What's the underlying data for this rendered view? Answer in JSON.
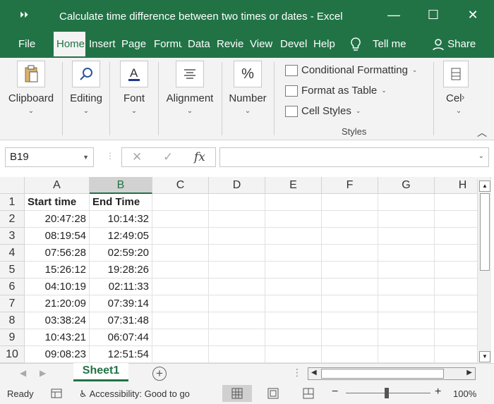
{
  "titlebar": {
    "quick_access": "⏵⏵",
    "title": "Calculate time difference between two times or dates  -  Excel",
    "minimize": "—",
    "restore": "☐",
    "close": "✕"
  },
  "tabs": {
    "file": "File",
    "home": "Home",
    "insert": "Insert",
    "page": "Page I",
    "formulas": "Formu",
    "data": "Data",
    "review": "Revie",
    "view": "View",
    "developer": "Devel",
    "help": "Help",
    "tell_me": "Tell me",
    "share": "Share"
  },
  "ribbon": {
    "clipboard": "Clipboard",
    "editing": "Editing",
    "font": "Font",
    "alignment": "Alignment",
    "number": "Number",
    "conditional_formatting": "Conditional Formatting",
    "format_as_table": "Format as Table",
    "cell_styles": "Cell Styles",
    "styles_group": "Styles",
    "cells": "Cel"
  },
  "formula_bar": {
    "name_box": "B19",
    "fx": "fx",
    "cancel": "✕",
    "enter": "✓",
    "value": ""
  },
  "grid": {
    "columns": [
      "A",
      "B",
      "C",
      "D",
      "E",
      "F",
      "G",
      "H"
    ],
    "selected_column": "B",
    "rows": [
      {
        "n": "1",
        "a": "Start time",
        "b": "End Time"
      },
      {
        "n": "2",
        "a": "20:47:28",
        "b": "10:14:32"
      },
      {
        "n": "3",
        "a": "08:19:54",
        "b": "12:49:05"
      },
      {
        "n": "4",
        "a": "07:56:28",
        "b": "02:59:20"
      },
      {
        "n": "5",
        "a": "15:26:12",
        "b": "19:28:26"
      },
      {
        "n": "6",
        "a": "04:10:19",
        "b": "02:11:33"
      },
      {
        "n": "7",
        "a": "21:20:09",
        "b": "07:39:14"
      },
      {
        "n": "8",
        "a": "03:38:24",
        "b": "07:31:48"
      },
      {
        "n": "9",
        "a": "10:43:21",
        "b": "06:07:44"
      },
      {
        "n": "10",
        "a": "09:08:23",
        "b": "12:51:54"
      }
    ]
  },
  "sheets": {
    "active": "Sheet1",
    "add": "+"
  },
  "status": {
    "ready": "Ready",
    "accessibility": "Accessibility: Good to go",
    "zoom_minus": "−",
    "zoom_plus": "+",
    "zoom": "100%"
  },
  "colors": {
    "brand_green": "#217346",
    "ribbon_bg": "#f3f3f3"
  }
}
